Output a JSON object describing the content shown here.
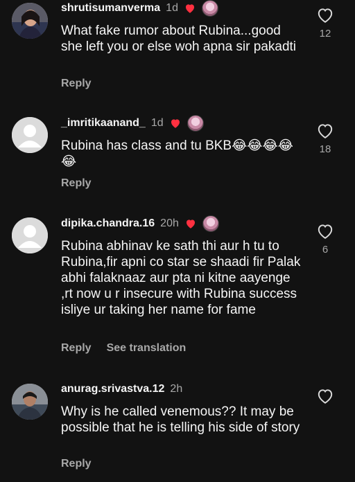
{
  "comments": [
    {
      "username": "shrutisumanverma",
      "time": "1d",
      "text": "What fake rumor about Rubina...good she left you or else woh apna sir pakadti",
      "reply_label": "Reply",
      "like_count": "12",
      "avatar": "profile-photo"
    },
    {
      "username": "_imritikaanand_",
      "time": "1d",
      "text": "Rubina has class and tu BKB😂😂😂😂😂",
      "reply_label": "Reply",
      "like_count": "18",
      "avatar": "default-avatar"
    },
    {
      "username": "dipika.chandra.16",
      "time": "20h",
      "text": "Rubina abhinav ke sath thi aur h tu to Rubina,fir apni co star se shaadi fir Palak abhi falaknaaz aur pta ni kitne aayenge ,rt now u r insecure with Rubina success isliye ur taking her name for fame",
      "reply_label": "Reply",
      "translation_label": "See translation",
      "like_count": "6",
      "avatar": "default-avatar"
    },
    {
      "username": "anurag.srivastva.12",
      "time": "2h",
      "text": "Why is he called venemous?? It may be possible that he is telling his side of story",
      "reply_label": "Reply",
      "like_count": "",
      "avatar": "profile-photo"
    }
  ],
  "colors": {
    "background": "#121212",
    "text": "#f5f5f5",
    "secondary": "#a8a8a8",
    "heart": "#ff3040"
  }
}
